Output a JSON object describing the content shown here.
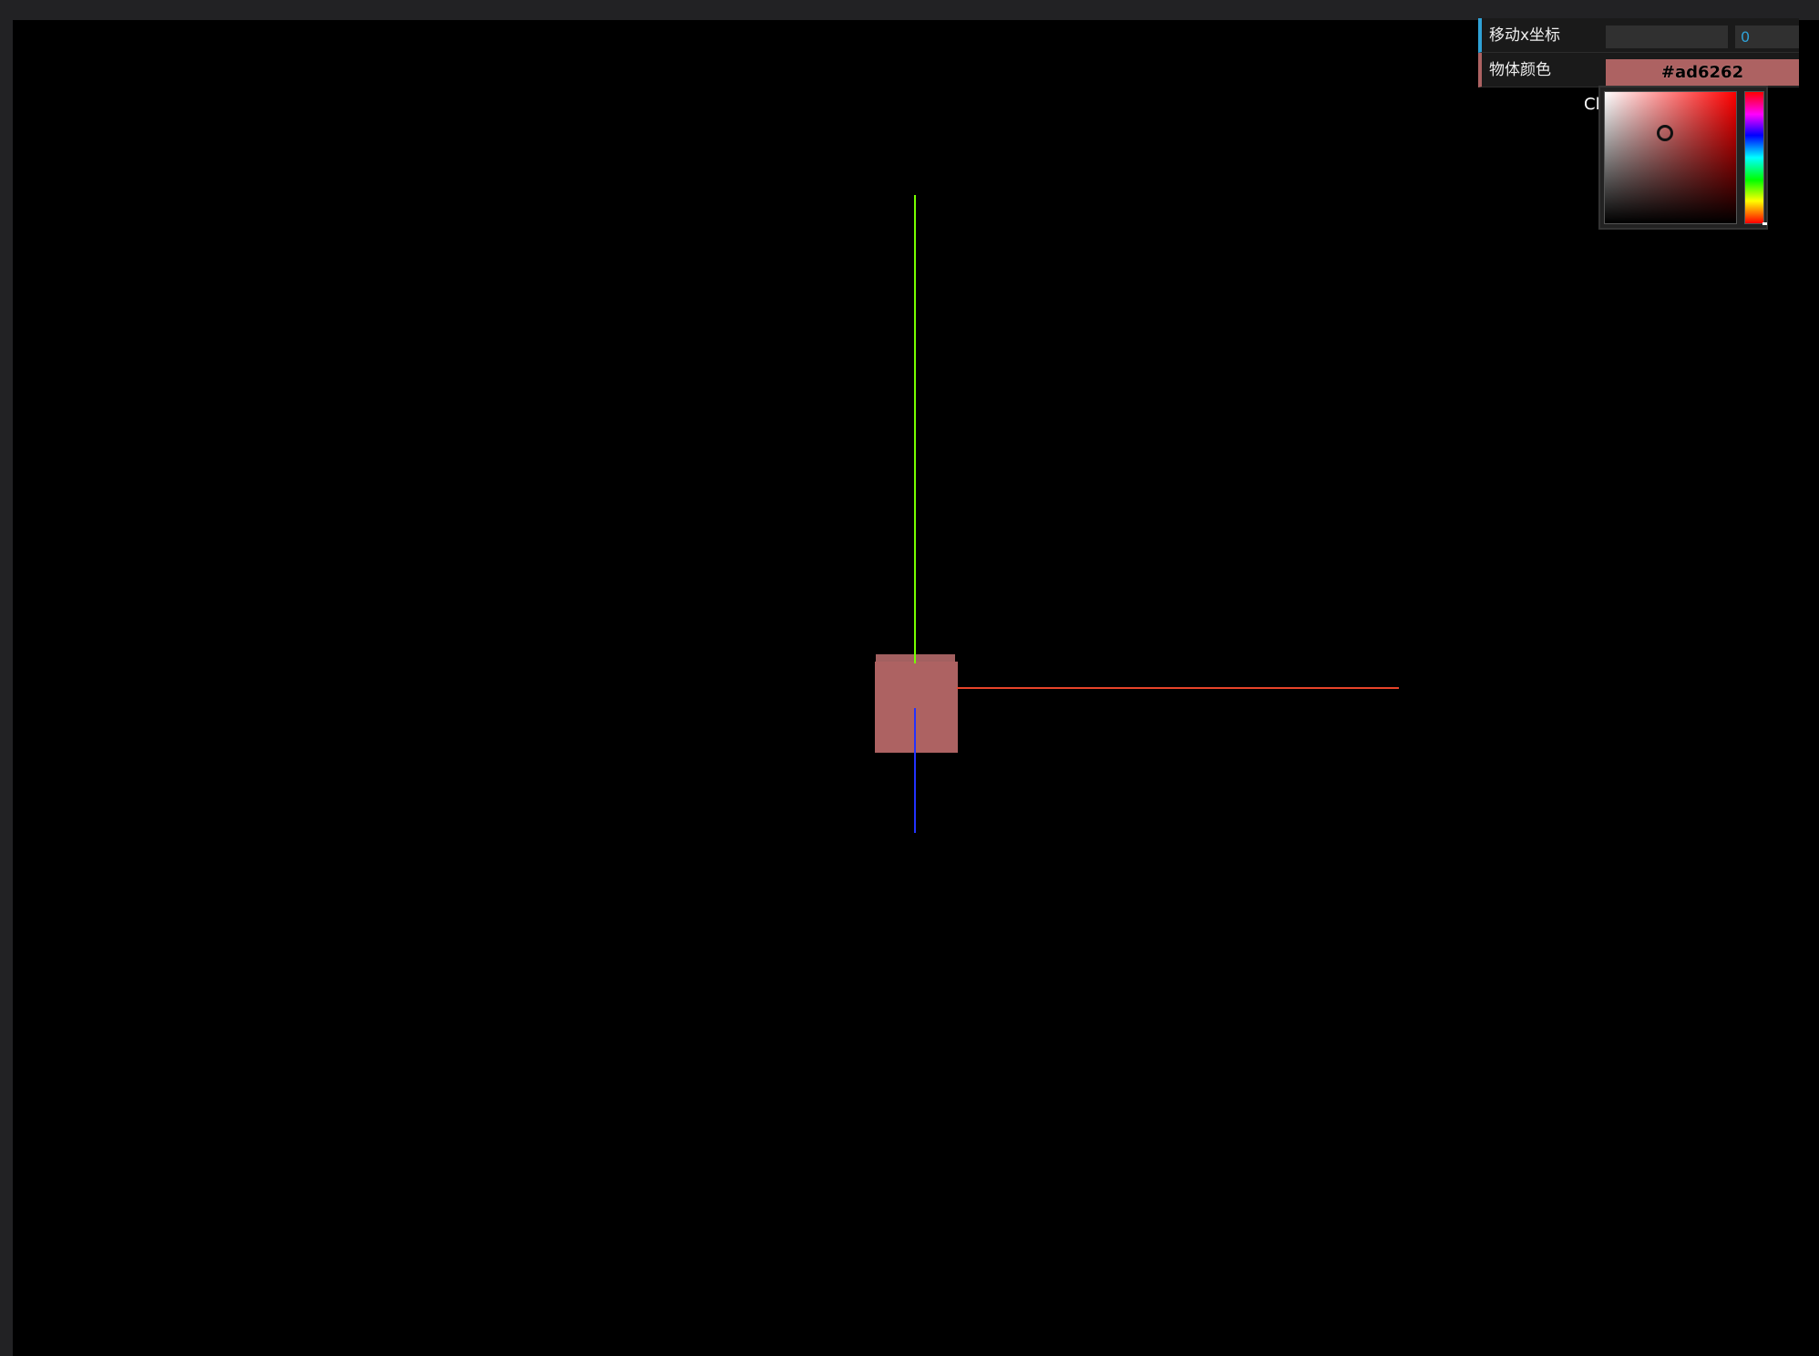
{
  "gui": {
    "controls": [
      {
        "label": "移动x坐标",
        "value": "0",
        "accent": "#2fa1d6"
      },
      {
        "label": "物体颜色",
        "value": "#ad6262",
        "accent": "#ad6262"
      }
    ],
    "close_label": "Cl",
    "color_picker": {
      "hue_color": "#ff0000",
      "selected_color": "#ad6262"
    }
  },
  "scene": {
    "background": "#000000",
    "object_color": "#ad6262",
    "axes": {
      "x_color": "#ff3300",
      "y_color": "#77ff00",
      "z_color": "#2233ff"
    }
  }
}
